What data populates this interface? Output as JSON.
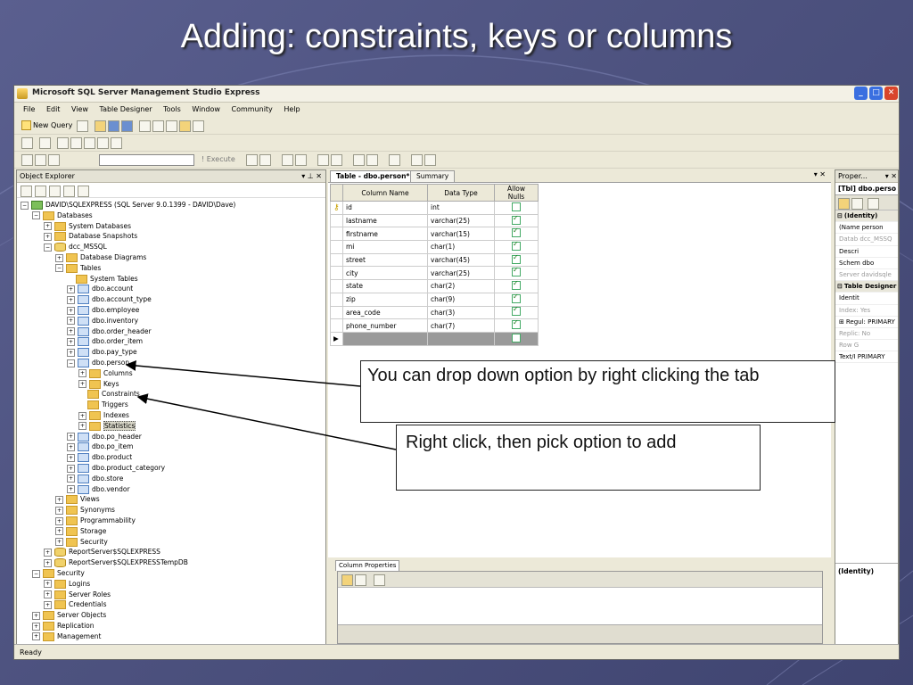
{
  "slide": {
    "title": "Adding: constraints, keys or columns"
  },
  "window": {
    "title": "Microsoft SQL Server Management Studio Express"
  },
  "menu": [
    "File",
    "Edit",
    "View",
    "Table Designer",
    "Tools",
    "Window",
    "Community",
    "Help"
  ],
  "toolbar": {
    "new_query": "New Query",
    "execute": "Execute"
  },
  "object_explorer": {
    "header": "Object Explorer",
    "tree": [
      {
        "label": "DAVID\\SQLEXPRESS (SQL Server 9.0.1399 - DAVID\\Dave)",
        "indent": 0,
        "exp": "-",
        "icon": "server"
      },
      {
        "label": "Databases",
        "indent": 1,
        "exp": "-",
        "icon": "folder"
      },
      {
        "label": "System Databases",
        "indent": 2,
        "exp": "+",
        "icon": "folder"
      },
      {
        "label": "Database Snapshots",
        "indent": 2,
        "exp": "+",
        "icon": "folder"
      },
      {
        "label": "dcc_MSSQL",
        "indent": 2,
        "exp": "-",
        "icon": "db"
      },
      {
        "label": "Database Diagrams",
        "indent": 3,
        "exp": "+",
        "icon": "folder"
      },
      {
        "label": "Tables",
        "indent": 3,
        "exp": "-",
        "icon": "folder"
      },
      {
        "label": "System Tables",
        "indent": 4,
        "exp": "",
        "icon": "folder"
      },
      {
        "label": "dbo.account",
        "indent": 4,
        "exp": "+",
        "icon": "table"
      },
      {
        "label": "dbo.account_type",
        "indent": 4,
        "exp": "+",
        "icon": "table"
      },
      {
        "label": "dbo.employee",
        "indent": 4,
        "exp": "+",
        "icon": "table"
      },
      {
        "label": "dbo.inventory",
        "indent": 4,
        "exp": "+",
        "icon": "table"
      },
      {
        "label": "dbo.order_header",
        "indent": 4,
        "exp": "+",
        "icon": "table"
      },
      {
        "label": "dbo.order_item",
        "indent": 4,
        "exp": "+",
        "icon": "table"
      },
      {
        "label": "dbo.pay_type",
        "indent": 4,
        "exp": "+",
        "icon": "table"
      },
      {
        "label": "dbo.person",
        "indent": 4,
        "exp": "-",
        "icon": "table"
      },
      {
        "label": "Columns",
        "indent": 5,
        "exp": "+",
        "icon": "folder"
      },
      {
        "label": "Keys",
        "indent": 5,
        "exp": "+",
        "icon": "folder"
      },
      {
        "label": "Constraints",
        "indent": 5,
        "exp": "",
        "icon": "folder"
      },
      {
        "label": "Triggers",
        "indent": 5,
        "exp": "",
        "icon": "folder"
      },
      {
        "label": "Indexes",
        "indent": 5,
        "exp": "+",
        "icon": "folder"
      },
      {
        "label": "Statistics",
        "indent": 5,
        "exp": "+",
        "icon": "folder",
        "selected": true
      },
      {
        "label": "dbo.po_header",
        "indent": 4,
        "exp": "+",
        "icon": "table"
      },
      {
        "label": "dbo.po_item",
        "indent": 4,
        "exp": "+",
        "icon": "table"
      },
      {
        "label": "dbo.product",
        "indent": 4,
        "exp": "+",
        "icon": "table"
      },
      {
        "label": "dbo.product_category",
        "indent": 4,
        "exp": "+",
        "icon": "table"
      },
      {
        "label": "dbo.store",
        "indent": 4,
        "exp": "+",
        "icon": "table"
      },
      {
        "label": "dbo.vendor",
        "indent": 4,
        "exp": "+",
        "icon": "table"
      },
      {
        "label": "Views",
        "indent": 3,
        "exp": "+",
        "icon": "folder"
      },
      {
        "label": "Synonyms",
        "indent": 3,
        "exp": "+",
        "icon": "folder"
      },
      {
        "label": "Programmability",
        "indent": 3,
        "exp": "+",
        "icon": "folder"
      },
      {
        "label": "Storage",
        "indent": 3,
        "exp": "+",
        "icon": "folder"
      },
      {
        "label": "Security",
        "indent": 3,
        "exp": "+",
        "icon": "folder"
      },
      {
        "label": "ReportServer$SQLEXPRESS",
        "indent": 2,
        "exp": "+",
        "icon": "db"
      },
      {
        "label": "ReportServer$SQLEXPRESSTempDB",
        "indent": 2,
        "exp": "+",
        "icon": "db"
      },
      {
        "label": "Security",
        "indent": 1,
        "exp": "-",
        "icon": "folder"
      },
      {
        "label": "Logins",
        "indent": 2,
        "exp": "+",
        "icon": "folder"
      },
      {
        "label": "Server Roles",
        "indent": 2,
        "exp": "+",
        "icon": "folder"
      },
      {
        "label": "Credentials",
        "indent": 2,
        "exp": "+",
        "icon": "folder"
      },
      {
        "label": "Server Objects",
        "indent": 1,
        "exp": "+",
        "icon": "folder"
      },
      {
        "label": "Replication",
        "indent": 1,
        "exp": "+",
        "icon": "folder"
      },
      {
        "label": "Management",
        "indent": 1,
        "exp": "+",
        "icon": "folder"
      }
    ]
  },
  "document": {
    "tabs": [
      "Table - dbo.person*",
      "Summary"
    ],
    "headers": [
      "Column Name",
      "Data Type",
      "Allow Nulls"
    ],
    "rows": [
      {
        "name": "id",
        "type": "int",
        "nulls": false,
        "key": true
      },
      {
        "name": "lastname",
        "type": "varchar(25)",
        "nulls": true
      },
      {
        "name": "firstname",
        "type": "varchar(15)",
        "nulls": true
      },
      {
        "name": "mi",
        "type": "char(1)",
        "nulls": true
      },
      {
        "name": "street",
        "type": "varchar(45)",
        "nulls": true
      },
      {
        "name": "city",
        "type": "varchar(25)",
        "nulls": true
      },
      {
        "name": "state",
        "type": "char(2)",
        "nulls": true
      },
      {
        "name": "zip",
        "type": "char(9)",
        "nulls": true
      },
      {
        "name": "area_code",
        "type": "char(3)",
        "nulls": true
      },
      {
        "name": "phone_number",
        "type": "char(7)",
        "nulls": true
      }
    ],
    "column_properties_tab": "Column Properties"
  },
  "properties": {
    "header": "Proper...",
    "selector": "[Tbl] dbo.perso",
    "rows": [
      {
        "text": "(Identity)",
        "kind": "cat",
        "sign": "⊟"
      },
      {
        "text": "(Name person",
        "kind": ""
      },
      {
        "text": "Datab dcc_MSSQ",
        "kind": "dim"
      },
      {
        "text": "Descri",
        "kind": ""
      },
      {
        "text": "Schem dbo",
        "kind": ""
      },
      {
        "text": "Server davidsqle",
        "kind": "dim"
      },
      {
        "text": "Table Designer",
        "kind": "cat",
        "sign": "⊟"
      },
      {
        "text": "Identit",
        "kind": ""
      },
      {
        "text": "Index: Yes",
        "kind": "dim"
      },
      {
        "text": "Regul: PRIMARY",
        "kind": "",
        "sign": "⊞"
      },
      {
        "text": "Replic: No",
        "kind": "dim"
      },
      {
        "text": "Row G",
        "kind": "dim"
      },
      {
        "text": "Text/I PRIMARY",
        "kind": ""
      }
    ],
    "footer": "(Identity)"
  },
  "status": "Ready",
  "callouts": {
    "first": "You can drop down option by right clicking the tab",
    "second": "Right click, then pick option to add"
  }
}
